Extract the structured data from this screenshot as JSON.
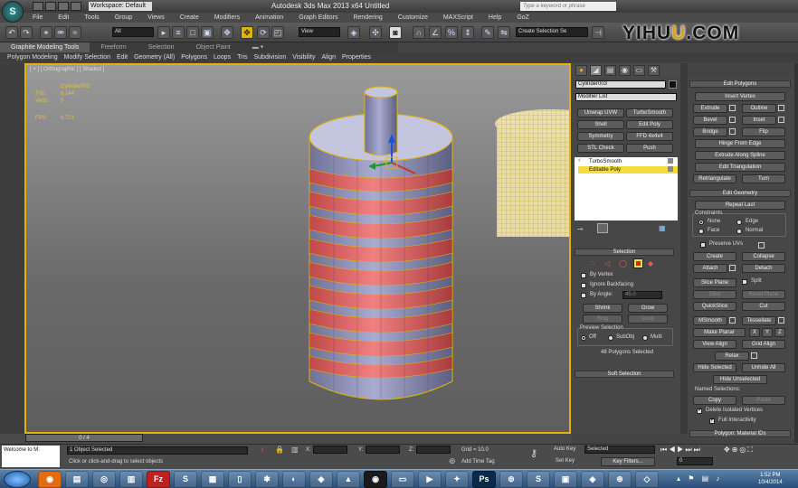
{
  "app": {
    "title": "Autodesk 3ds Max 2013 x64     Untitled",
    "workspace": "Workspace: Default",
    "search_placeholder": "Type a keyword or phrase",
    "logo_a": "YIHU",
    "logo_b": "U",
    "logo_c": ".COM"
  },
  "menu": [
    "File",
    "Edit",
    "Tools",
    "Group",
    "Views",
    "Create",
    "Modifiers",
    "Animation",
    "Graph Editors",
    "Rendering",
    "Customize",
    "MAXScript",
    "Help",
    "GoZ"
  ],
  "toolbar": {
    "filter_value": "All",
    "refcoord_value": "View",
    "named_sel_placeholder": "Create Selection Se"
  },
  "ribbon": {
    "tabs": [
      "Graphite Modeling Tools",
      "Freeform",
      "Selection",
      "Object Paint"
    ],
    "items": [
      "Polygon Modeling",
      "Modify Selection",
      "Edit",
      "Geometry (All)",
      "Polygons",
      "Loops",
      "Tris",
      "Subdivision",
      "Visibility",
      "Align",
      "Properties"
    ]
  },
  "viewport": {
    "label": "[ + ] [ Orthographic ] [ Shaded ]",
    "object_name": "Cylinder003",
    "tris_label": "Tris:",
    "tris_value": "6.144",
    "verts_label": "Verts:",
    "verts_value": "0",
    "fps_label": "FPS:",
    "fps_value": "6.721"
  },
  "timeline": {
    "slider": "0 / 4"
  },
  "status": {
    "welcome": "Welcome to M:",
    "selected": "1 Object Selected",
    "prompt": "Click or click-and-drag to select objects",
    "x_label": "X:",
    "y_label": "Y:",
    "z_label": "Z:",
    "grid": "Grid = 10.0",
    "add_time_tag": "Add Time Tag",
    "auto_key": "Auto Key",
    "set_key": "Set Key",
    "selected_dropdown": "Selected",
    "key_filters": "Key Filters...",
    "frame_value": "0"
  },
  "command_panel": {
    "object_name": "Cylinder003",
    "modifier_list": "Modifier List",
    "buttons": [
      "Unwrap UVW",
      "TurboSmooth",
      "Shell",
      "Edit Poly",
      "Symmetry",
      "FFD 4x4x4",
      "STL Check",
      "Push"
    ],
    "stack": [
      "TurboSmooth",
      "Editable Poly"
    ],
    "selection": {
      "title": "Selection",
      "by_vertex": "By Vertex",
      "ignore_backfacing": "Ignore Backfacing",
      "by_angle": "By Angle:",
      "angle_value": "45.0",
      "shrink": "Shrink",
      "grow": "Grow",
      "ring": "Ring",
      "loop": "Loop",
      "preview_selection": "Preview Selection",
      "off": "Off",
      "subobj": "SubObj",
      "multi": "Multi",
      "status": "48 Polygons Selected"
    },
    "soft_selection": "Soft Selection"
  },
  "edit_panel": {
    "edit_polygons": "Edit Polygons",
    "insert_vertex": "Insert Vertex",
    "extrude": "Extrude",
    "outline": "Outline",
    "bevel": "Bevel",
    "inset": "Inset",
    "bridge": "Bridge",
    "flip": "Flip",
    "hinge": "Hinge From Edge",
    "extrude_spline": "Extrude Along Spline",
    "edit_triangulation": "Edit Triangulation",
    "retriangulate": "Retriangulate",
    "turn": "Turn",
    "edit_geometry": "Edit Geometry",
    "repeat_last": "Repeat Last",
    "constraints": "Constraints",
    "none": "None",
    "edge": "Edge",
    "face": "Face",
    "normal": "Normal",
    "preserve_uvs": "Preserve UVs",
    "create": "Create",
    "collapse": "Collapse",
    "attach": "Attach",
    "detach": "Detach",
    "slice_plane": "Slice Plane",
    "split": "Split",
    "slice": "Slice",
    "reset_plane": "Reset Plane",
    "quickslice": "QuickSlice",
    "cut": "Cut",
    "msmooth": "MSmooth",
    "tessellate": "Tessellate",
    "make_planar": "Make Planar",
    "x": "X",
    "y": "Y",
    "z": "Z",
    "view_align": "View Align",
    "grid_align": "Grid Align",
    "relax": "Relax",
    "hide_selected": "Hide Selected",
    "unhide_all": "Unhide All",
    "hide_unselected": "Hide Unselected",
    "named_selections": "Named Selections:",
    "copy": "Copy",
    "paste": "Paste",
    "delete_isolated": "Delete Isolated Vertices",
    "full_interactivity": "Full Interactivity",
    "polygon_material": "Polygon: Material IDs"
  },
  "taskbar": {
    "time": "1:52 PM",
    "date": "10/4/2014"
  },
  "colors": {
    "accent": "#e3b300",
    "selected_poly": "#e05a5a",
    "object_fill": "#8f93b8"
  }
}
